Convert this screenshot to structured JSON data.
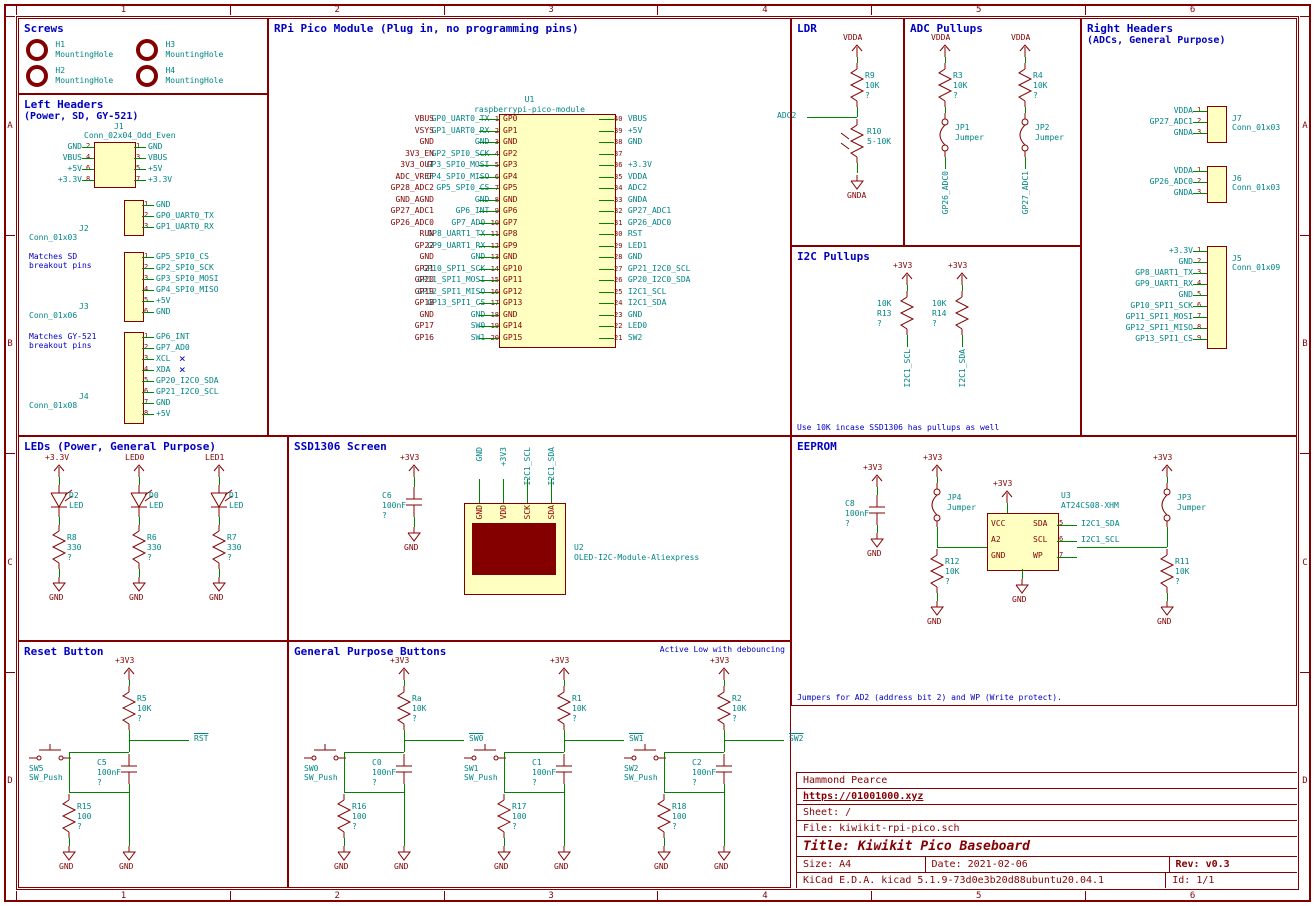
{
  "ruler_cols": [
    "1",
    "2",
    "3",
    "4",
    "5",
    "6"
  ],
  "ruler_rows": [
    "A",
    "B",
    "C",
    "D"
  ],
  "blocks": {
    "screws": {
      "title": "Screws",
      "holes": [
        {
          "ref": "H1",
          "val": "MountingHole"
        },
        {
          "ref": "H2",
          "val": "MountingHole"
        },
        {
          "ref": "H3",
          "val": "MountingHole"
        },
        {
          "ref": "H4",
          "val": "MountingHole"
        }
      ]
    },
    "left_headers": {
      "title": "Left Headers",
      "subtitle": "(Power, SD, GY-521)",
      "j1": {
        "ref": "J1",
        "val": "Conn_02x04_Odd_Even",
        "left": [
          "GND",
          "VBUS",
          "+5V",
          "+3.3V"
        ],
        "lp": [
          "2",
          "4",
          "6",
          "8"
        ],
        "right": [
          "GND",
          "VBUS",
          "+5V",
          "+3.3V"
        ],
        "rp": [
          "1",
          "3",
          "5",
          "7"
        ]
      },
      "j2": {
        "ref": "J2",
        "val": "Conn_01x03",
        "pins": [
          "1",
          "2",
          "3"
        ],
        "nets": [
          "GND",
          "GP0_UART0_TX",
          "GP1_UART0_RX"
        ]
      },
      "j3": {
        "ref": "J3",
        "val": "Conn_01x06",
        "note": "Matches SD breakout pins",
        "pins": [
          "1",
          "2",
          "3",
          "4",
          "5",
          "6"
        ],
        "nets": [
          "GP5_SPI0_CS",
          "GP2_SPI0_SCK",
          "GP3_SPI0_MOSI",
          "GP4_SPI0_MISO",
          "+5V",
          "GND"
        ]
      },
      "j4": {
        "ref": "J4",
        "val": "Conn_01x08",
        "note": "Matches GY-521 breakout pins",
        "pins": [
          "1",
          "2",
          "3",
          "4",
          "5",
          "6",
          "7",
          "8"
        ],
        "nets": [
          "GP6_INT",
          "GP7_AD0",
          "XCL",
          "XDA",
          "GP20_I2C0_SDA",
          "GP21_I2C0_SCL",
          "GND",
          "+5V"
        ]
      }
    },
    "leds": {
      "title": "LEDs (Power, General Purpose)",
      "items": [
        {
          "pwr": "+3.3V",
          "led": {
            "ref": "D2",
            "val": "LED"
          },
          "r": {
            "ref": "R8",
            "val": "330"
          },
          "gnd": "GND",
          "net": ""
        },
        {
          "pwr": "LED0",
          "led": {
            "ref": "D0",
            "val": "LED"
          },
          "r": {
            "ref": "R6",
            "val": "330"
          },
          "gnd": "GND",
          "net": ""
        },
        {
          "pwr": "LED1",
          "led": {
            "ref": "D1",
            "val": "LED"
          },
          "r": {
            "ref": "R7",
            "val": "330"
          },
          "gnd": "GND",
          "net": ""
        }
      ]
    },
    "reset": {
      "title": "Reset Button",
      "pwr": "+3V3",
      "r_top": {
        "ref": "R5",
        "val": "10K"
      },
      "net": "RST",
      "cap": {
        "ref": "C5",
        "val": "100nF"
      },
      "sw": {
        "ref": "SW5",
        "val": "SW_Push"
      },
      "r_bot": {
        "ref": "R15",
        "val": "100"
      },
      "gnd": "GND"
    },
    "pico": {
      "title": "RPi Pico Module (Plug in, no programming pins)",
      "ref": "U1",
      "val": "raspberrypi-pico-module",
      "left_pins": [
        {
          "n": "1",
          "name": "GP0",
          "net": "GP0_UART0_TX"
        },
        {
          "n": "2",
          "name": "GP1",
          "net": "GP1_UART0_RX"
        },
        {
          "n": "3",
          "name": "GND",
          "net": "GND"
        },
        {
          "n": "4",
          "name": "GP2",
          "net": "GP2_SPI0_SCK"
        },
        {
          "n": "5",
          "name": "GP3",
          "net": "GP3_SPI0_MOSI"
        },
        {
          "n": "6",
          "name": "GP4",
          "net": "GP4_SPI0_MISO"
        },
        {
          "n": "7",
          "name": "GP5",
          "net": "GP5_SPI0_CS"
        },
        {
          "n": "8",
          "name": "GND",
          "net": "GND"
        },
        {
          "n": "9",
          "name": "GP6",
          "net": "GP6_INT"
        },
        {
          "n": "10",
          "name": "GP7",
          "net": "GP7_AD0"
        },
        {
          "n": "11",
          "name": "GP8",
          "net": "GP8_UART1_TX"
        },
        {
          "n": "12",
          "name": "GP9",
          "net": "GP9_UART1_RX"
        },
        {
          "n": "13",
          "name": "GND",
          "net": "GND"
        },
        {
          "n": "14",
          "name": "GP10",
          "net": "GP10_SPI1_SCK"
        },
        {
          "n": "15",
          "name": "GP11",
          "net": "GP11_SPI1_MOSI"
        },
        {
          "n": "16",
          "name": "GP12",
          "net": "GP12_SPI1_MISO"
        },
        {
          "n": "17",
          "name": "GP13",
          "net": "GP13_SPI1_CS"
        },
        {
          "n": "18",
          "name": "GND",
          "net": "GND"
        },
        {
          "n": "19",
          "name": "GP14",
          "net": "SW0"
        },
        {
          "n": "20",
          "name": "GP15",
          "net": "SW1"
        }
      ],
      "right_pins": [
        {
          "n": "40",
          "name": "VBUS",
          "net": "VBUS"
        },
        {
          "n": "39",
          "name": "VSYS",
          "net": "+5V"
        },
        {
          "n": "38",
          "name": "GND",
          "net": "GND"
        },
        {
          "n": "37",
          "name": "3V3_EN",
          "net": ""
        },
        {
          "n": "36",
          "name": "3V3_OUT",
          "net": "+3.3V"
        },
        {
          "n": "35",
          "name": "ADC_VREF",
          "net": "VDDA"
        },
        {
          "n": "34",
          "name": "GP28_ADC2",
          "net": "ADC2"
        },
        {
          "n": "33",
          "name": "GND_AGND",
          "net": "GNDA"
        },
        {
          "n": "32",
          "name": "GP27_ADC1",
          "net": "GP27_ADC1"
        },
        {
          "n": "31",
          "name": "GP26_ADC0",
          "net": "GP26_ADC0"
        },
        {
          "n": "30",
          "name": "RUN",
          "net": "RST"
        },
        {
          "n": "29",
          "name": "GP22",
          "net": "LED1"
        },
        {
          "n": "28",
          "name": "GND",
          "net": "GND"
        },
        {
          "n": "27",
          "name": "GP21",
          "net": "GP21_I2C0_SCL"
        },
        {
          "n": "26",
          "name": "GP20",
          "net": "GP20_I2C0_SDA"
        },
        {
          "n": "25",
          "name": "GP19",
          "net": "I2C1_SCL"
        },
        {
          "n": "24",
          "name": "GP18",
          "net": "I2C1_SDA"
        },
        {
          "n": "23",
          "name": "GND",
          "net": "GND"
        },
        {
          "n": "22",
          "name": "GP17",
          "net": "LED0"
        },
        {
          "n": "21",
          "name": "GP16",
          "net": "SW2"
        }
      ]
    },
    "ssd1306": {
      "title": "SSD1306 Screen",
      "ref": "U2",
      "val": "OLED-I2C-Module-Aliexpress",
      "cap": {
        "ref": "C6",
        "val": "100nF"
      },
      "pwr": "+3V3",
      "gnd": "GND",
      "pins": [
        "GND",
        "VDD",
        "SCK",
        "SDA"
      ],
      "nets": [
        "GND",
        "+3V3",
        "I2C1_SCL",
        "I2C1_SDA"
      ]
    },
    "gpbuttons": {
      "title": "General Purpose Buttons",
      "note": "Active Low with debouncing",
      "items": [
        {
          "pwr": "+3V3",
          "r_top": {
            "ref": "Ra",
            "val": "10K"
          },
          "net": "SW0",
          "sw": {
            "ref": "SW0",
            "val": "SW_Push"
          },
          "cap": {
            "ref": "C0",
            "val": "100nF"
          },
          "r_bot": {
            "ref": "R16",
            "val": "100"
          },
          "gnd": "GND"
        },
        {
          "pwr": "+3V3",
          "r_top": {
            "ref": "R1",
            "val": "10K"
          },
          "net": "SW1",
          "sw": {
            "ref": "SW1",
            "val": "SW_Push"
          },
          "cap": {
            "ref": "C1",
            "val": "100nF"
          },
          "r_bot": {
            "ref": "R17",
            "val": "100"
          },
          "gnd": "GND"
        },
        {
          "pwr": "+3V3",
          "r_top": {
            "ref": "R2",
            "val": "10K"
          },
          "net": "SW2",
          "sw": {
            "ref": "SW2",
            "val": "SW_Push"
          },
          "cap": {
            "ref": "C2",
            "val": "100nF"
          },
          "r_bot": {
            "ref": "R18",
            "val": "100"
          },
          "gnd": "GND"
        }
      ]
    },
    "ldr": {
      "title": "LDR",
      "pwr": "VDDA",
      "gnd": "GNDA",
      "net": "ADC2",
      "r": {
        "ref": "R9",
        "val": "10K"
      },
      "ldr": {
        "ref": "R10",
        "val": "5-10K"
      }
    },
    "adc_pullups": {
      "title": "ADC Pullups",
      "items": [
        {
          "pwr": "VDDA",
          "r": {
            "ref": "R3",
            "val": "10K"
          },
          "jp": {
            "ref": "JP1",
            "val": "Jumper"
          },
          "net": "GP26_ADC0"
        },
        {
          "pwr": "VDDA",
          "r": {
            "ref": "R4",
            "val": "10K"
          },
          "jp": {
            "ref": "JP2",
            "val": "Jumper"
          },
          "net": "GP27_ADC1"
        }
      ]
    },
    "i2c_pullups": {
      "title": "I2C Pullups",
      "note": "Use 10K incase SSD1306 has pullups as well",
      "items": [
        {
          "pwr": "+3V3",
          "r": {
            "ref": "R13",
            "val": "10K"
          },
          "net": "I2C1_SCL"
        },
        {
          "pwr": "+3V3",
          "r": {
            "ref": "R14",
            "val": "10K"
          },
          "net": "I2C1_SDA"
        }
      ]
    },
    "right_headers": {
      "title": "Right Headers",
      "subtitle": "(ADCs, General Purpose)",
      "j7": {
        "ref": "J7",
        "val": "Conn_01x03",
        "pins": [
          "1",
          "2",
          "3"
        ],
        "nets": [
          "VDDA",
          "GP27_ADC1",
          "GNDA"
        ]
      },
      "j6": {
        "ref": "J6",
        "val": "Conn_01x03",
        "pins": [
          "1",
          "2",
          "3"
        ],
        "nets": [
          "VDDA",
          "GP26_ADC0",
          "GNDA"
        ]
      },
      "j5": {
        "ref": "J5",
        "val": "Conn_01x09",
        "pins": [
          "1",
          "2",
          "3",
          "4",
          "5",
          "6",
          "7",
          "8",
          "9"
        ],
        "nets": [
          "+3.3V",
          "GND",
          "GP8_UART1_TX",
          "GP9_UART1_RX",
          "GND",
          "GP10_SPI1_SCK",
          "GP11_SPI1_MOSI",
          "GP12_SPI1_MISO",
          "GP13_SPI1_CS"
        ]
      }
    },
    "eeprom": {
      "title": "EEPROM",
      "ref": "U3",
      "val": "AT24CS08-XHM",
      "pwr": "+3V3",
      "gnd": "GND",
      "cap": {
        "ref": "C8",
        "val": "100nF"
      },
      "jp4": {
        "ref": "JP4",
        "val": "Jumper"
      },
      "jp3": {
        "ref": "JP3",
        "val": "Jumper"
      },
      "r12": {
        "ref": "R12",
        "val": "10K"
      },
      "r11": {
        "ref": "R11",
        "val": "10K"
      },
      "pins_l": [
        "VCC",
        "A2",
        "GND"
      ],
      "pins_r": [
        {
          "n": "5",
          "name": "SDA",
          "net": "I2C1_SDA"
        },
        {
          "n": "6",
          "name": "SCL",
          "net": "I2C1_SCL"
        },
        {
          "n": "7",
          "name": "WP",
          "net": ""
        }
      ],
      "note": "Jumpers for AD2 (address bit 2) and WP (Write protect)."
    }
  },
  "title_block": {
    "author": "Hammond Pearce",
    "link": "https://01001000.xyz",
    "sheet": "Sheet: /",
    "file": "File: kiwikit-rpi-pico.sch",
    "title": "Title: Kiwikit Pico Baseboard",
    "size": "Size: A4",
    "date": "Date: 2021-02-06",
    "rev": "Rev: v0.3",
    "tool": "KiCad E.D.A.  kicad 5.1.9-73d0e3b20d88ubuntu20.04.1",
    "id": "Id: 1/1"
  }
}
